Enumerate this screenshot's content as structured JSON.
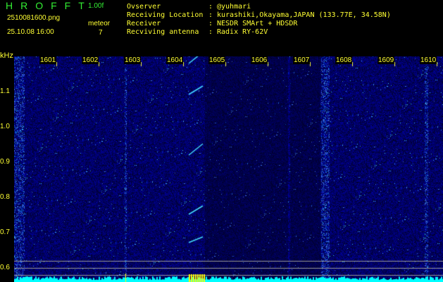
{
  "header": {
    "app_title": "HROFFT",
    "version": "1.00f",
    "filename": "2510081600.png",
    "datetime": "25.10.08 16:00",
    "meteor_label": "meteor",
    "meteor_count": "7",
    "info": [
      {
        "label": "Ovserver",
        "value": "@yuhmari"
      },
      {
        "label": "Receiving Location",
        "value": "kurashiki,Okayama,JAPAN (133.77E, 34.58N)"
      },
      {
        "label": "Receiver",
        "value": "NESDR SMArt + HDSDR"
      },
      {
        "label": "Recviving antenna",
        "value": "Radix RY-62V"
      }
    ]
  },
  "spectrogram": {
    "y_unit": "kHz",
    "y_labels": [
      "1.1",
      "1.0",
      "0.9",
      "0.8",
      "0.7",
      "0.6"
    ],
    "x_labels": [
      "1601",
      "1602",
      "1603",
      "1604",
      "1605",
      "1606",
      "1607",
      "1608",
      "1609",
      "1610"
    ],
    "colors": {
      "label": "#ffff33",
      "histogram": "#00ffff",
      "meteor_bar": "#ffff00"
    }
  }
}
